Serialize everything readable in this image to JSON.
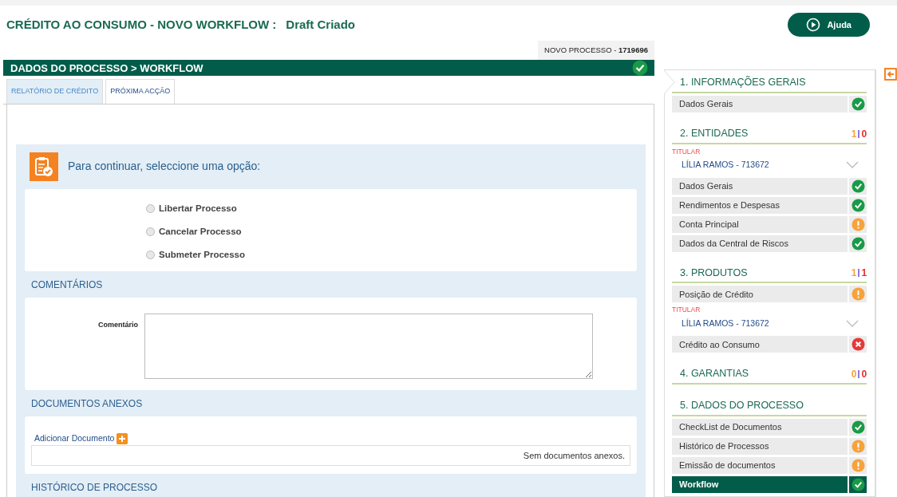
{
  "header": {
    "title": "CRÉDITO AO CONSUMO - NOVO WORKFLOW :",
    "status": "Draft Criado",
    "help_button": "Ajuda",
    "process_label": "NOVO PROCESSO - ",
    "process_number": "1719696"
  },
  "section_bar": {
    "title": "DADOS DO PROCESSO > WORKFLOW",
    "done": true,
    "failed": false
  },
  "tabs": [
    {
      "label": "RELATÓRIO DE CRÉDITO",
      "selected": false
    },
    {
      "label": "PRÓXIMA ACÇÃO",
      "selected": true
    }
  ],
  "action_panel": {
    "prompt": "Para continuar, seleccione uma opção:",
    "options": [
      {
        "label": "Libertar Processo",
        "selected": false
      },
      {
        "label": "Cancelar Processo",
        "selected": false
      },
      {
        "label": "Submeter Processo",
        "selected": false
      }
    ]
  },
  "comments": {
    "heading": "COMENTÁRIOS",
    "label": "Comentário"
  },
  "documents": {
    "heading": "DOCUMENTOS ANEXOS",
    "add_link": "Adicionar Documento",
    "empty_text": "Sem documentos anexos."
  },
  "history": {
    "heading": "HISTÓRICO DE PROCESSO"
  },
  "sidebar": {
    "sections": [
      {
        "title": "1. INFORMAÇÕES GERAIS",
        "items": [
          {
            "kind": "item",
            "label": "Dados Gerais",
            "done": true,
            "failed": false,
            "selected": false
          }
        ]
      },
      {
        "title": "2. ENTIDADES",
        "warnings": "1",
        "errors": "0",
        "items": [
          {
            "kind": "entity",
            "role": "TITULAR",
            "label": "LÍLIA RAMOS - 713672"
          },
          {
            "kind": "item",
            "label": "Dados Gerais",
            "done": true,
            "failed": false,
            "selected": false
          },
          {
            "kind": "item",
            "label": "Rendimentos e Despesas",
            "done": true,
            "failed": false,
            "selected": false
          },
          {
            "kind": "item",
            "label": "Conta Principal",
            "done": false,
            "failed": false,
            "selected": false
          },
          {
            "kind": "item",
            "label": "Dados da Central de Riscos",
            "done": true,
            "failed": false,
            "selected": false
          }
        ]
      },
      {
        "title": "3. PRODUTOS",
        "warnings": "1",
        "errors": "1",
        "items": [
          {
            "kind": "item",
            "label": "Posição de Crédito",
            "done": false,
            "failed": false,
            "selected": false
          },
          {
            "kind": "entity",
            "role": "TITULAR",
            "label": "LÍLIA RAMOS - 713672"
          },
          {
            "kind": "item",
            "label": "Crédito ao Consumo",
            "failed": true,
            "selected": false
          }
        ]
      },
      {
        "title": "4. GARANTIAS",
        "warnings": "0",
        "errors": "0"
      },
      {
        "title": "5. DADOS DO PROCESSO",
        "items": [
          {
            "kind": "item",
            "label": "CheckList de Documentos",
            "done": true,
            "failed": false,
            "selected": false
          },
          {
            "kind": "item",
            "label": "Histórico de Processos",
            "done": false,
            "failed": false,
            "selected": false
          },
          {
            "kind": "item",
            "label": "Emissão de documentos",
            "done": false,
            "failed": false,
            "selected": false
          },
          {
            "kind": "item",
            "label": "Workflow",
            "done": true,
            "failed": false,
            "selected": true
          }
        ]
      }
    ]
  }
}
